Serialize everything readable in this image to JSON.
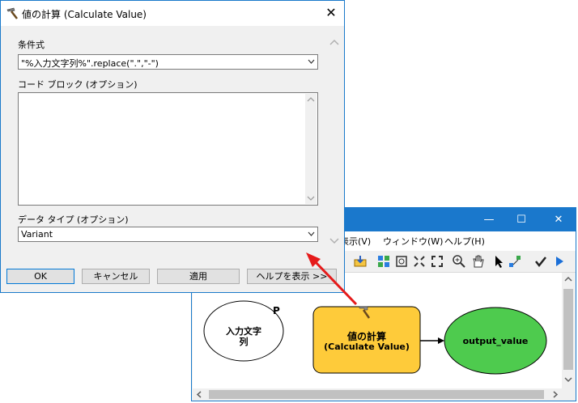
{
  "model_window": {
    "menu": [
      "表示(V)",
      "ウィンドウ(W)",
      "ヘルプ(H)"
    ],
    "minimize_label": "—",
    "maximize_label": "☐",
    "close_label": "✕",
    "nodes": {
      "input_label": "入力文字\n列",
      "input_flag": "P",
      "tool_label_line1": "値の計算",
      "tool_label_line2": "(Calculate Value)",
      "output_label": "output_value"
    }
  },
  "dialog": {
    "title": "値の計算 (Calculate Value)",
    "close_label": "✕",
    "expression_label": "条件式",
    "expression_value": "\"%入力文字列%\".replace(\".\",\"-\")",
    "code_block_label": "コード ブロック (オプション)",
    "data_type_label": "データ タイプ (オプション)",
    "data_type_value": "Variant",
    "buttons": {
      "ok": "OK",
      "cancel": "キャンセル",
      "apply": "適用",
      "help": "ヘルプを表示 >>"
    }
  },
  "colors": {
    "titlebar_blue": "#1a78cc",
    "tool_fill": "#fecb3a",
    "output_fill": "#4ecb4e",
    "arrow_red": "#e51a1a"
  }
}
